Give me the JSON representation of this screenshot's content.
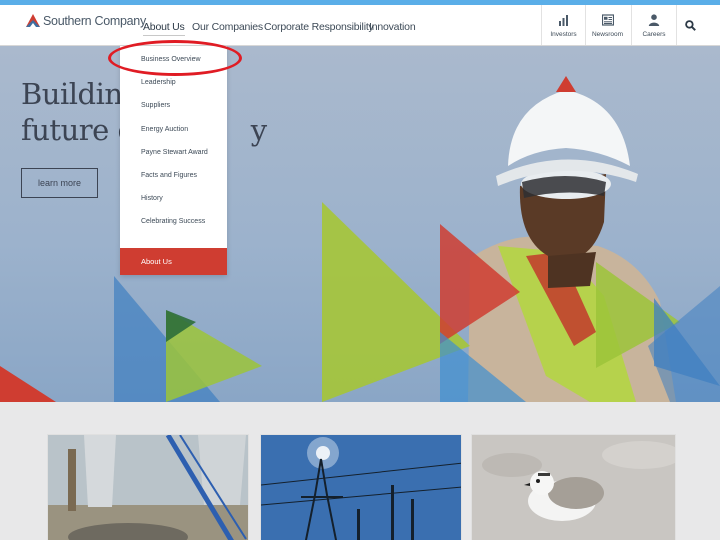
{
  "brand": {
    "name": "Southern Company",
    "accent": "#cf3d31",
    "nav_active_strip": "#5aaee8"
  },
  "nav": {
    "links": [
      "About Us",
      "Our Companies",
      "Corporate Responsibility",
      "Innovation"
    ],
    "active": "About Us"
  },
  "utility": [
    {
      "label": "Investors",
      "icon": "bar-chart-icon"
    },
    {
      "label": "Newsroom",
      "icon": "newspaper-icon"
    },
    {
      "label": "Careers",
      "icon": "person-icon"
    }
  ],
  "search": {
    "icon": "search-icon"
  },
  "hero": {
    "title_line1": "Building",
    "title_line2": "future of",
    "title_line2_end": "y",
    "button_label": "learn more"
  },
  "dropdown": {
    "items": [
      "Business Overview",
      "Leadership",
      "Suppliers",
      "Energy Auction",
      "Payne Stewart Award",
      "Facts and Figures",
      "History",
      "Celebrating Success"
    ],
    "footer": "About Us",
    "highlighted": "Business Overview",
    "highlight_color": "#e01c24"
  },
  "cards": [
    {
      "image": "construction-site-photo"
    },
    {
      "image": "power-lines-photo"
    },
    {
      "image": "shorebird-photo"
    }
  ]
}
